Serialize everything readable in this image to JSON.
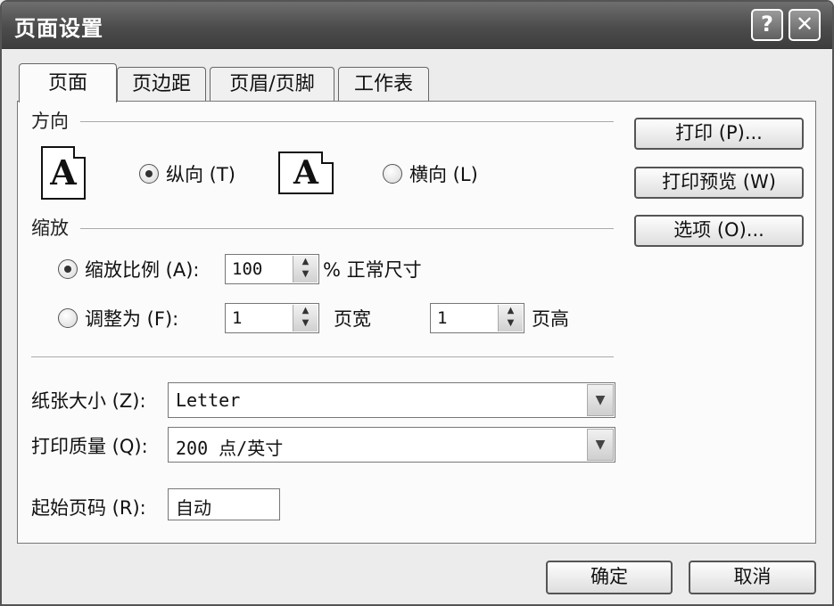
{
  "window": {
    "title": "页面设置",
    "help": "?",
    "close": "✕"
  },
  "tabs": [
    "页面",
    "页边距",
    "页眉/页脚",
    "工作表"
  ],
  "orientation": {
    "label": "方向",
    "icon_letter": "A",
    "portrait": "纵向 (T)",
    "landscape": "横向 (L)",
    "selected": "portrait"
  },
  "scaling": {
    "label": "缩放",
    "adjust_label": "缩放比例 (A):",
    "adjust_value": "100",
    "adjust_suffix": "% 正常尺寸",
    "fit_label": "调整为 (F):",
    "fit_wide_value": "1",
    "fit_wide_suffix": "页宽",
    "fit_tall_value": "1",
    "fit_tall_suffix": "页高",
    "selected": "adjust"
  },
  "paper_size": {
    "label": "纸张大小 (Z):",
    "value": "Letter"
  },
  "print_quality": {
    "label": "打印质量 (Q):",
    "value": "200 点/英寸"
  },
  "first_page": {
    "label": "起始页码 (R):",
    "value": "自动"
  },
  "side_buttons": {
    "print": "打印 (P)...",
    "preview": "打印预览 (W)",
    "options": "选项 (O)..."
  },
  "footer": {
    "ok": "确定",
    "cancel": "取消"
  },
  "icons": {
    "spin": "spin-arrows-icon",
    "dropdown": "chevron-down-icon"
  }
}
